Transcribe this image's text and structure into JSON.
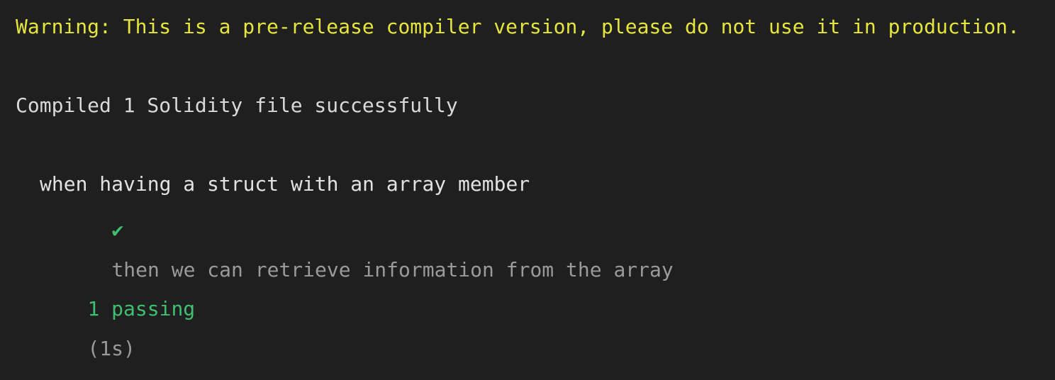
{
  "terminal": {
    "warning": "Warning: This is a pre-release compiler version, please do not use it in production.",
    "compiled": "Compiled 1 Solidity file successfully",
    "suite": "when having a struct with an array member",
    "test_mark": "✔",
    "test": "then we can retrieve information from the array",
    "passing": "1 passing",
    "duration": "(1s)"
  },
  "colors": {
    "background": "#1f1f1f",
    "warning": "#e5e53f",
    "success": "#3fbf6f",
    "muted": "#9a9a9a"
  }
}
